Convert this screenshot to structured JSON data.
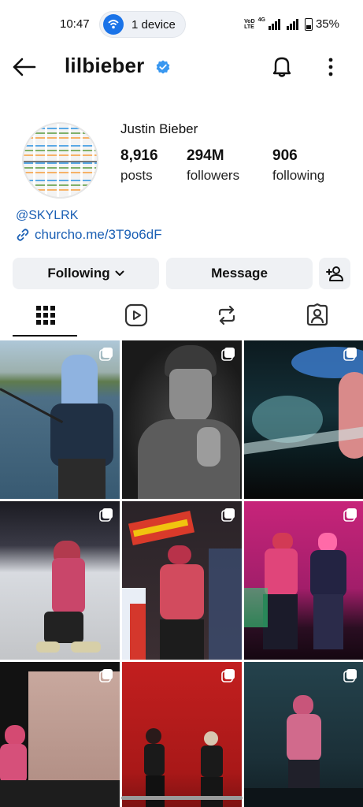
{
  "status_bar": {
    "time": "10:47",
    "device_pill": "1 device",
    "network_tiny_top": "VoD",
    "network_tiny_bottom": "LTE",
    "network_gen": "4G",
    "battery": "35%"
  },
  "header": {
    "username": "lilbieber"
  },
  "profile": {
    "full_name": "Justin Bieber",
    "posts_count": "8,916",
    "posts_label": "posts",
    "followers_count": "294M",
    "followers_label": "followers",
    "following_count": "906",
    "following_label": "following",
    "threads_handle": "@SKYLRK",
    "link": "churcho.me/3T9o6dF"
  },
  "actions": {
    "following_label": "Following",
    "message_label": "Message"
  },
  "tabs": [
    "grid-icon",
    "reels-icon",
    "reposts-icon",
    "tagged-icon"
  ],
  "grid_posts": [
    {
      "id": "post-1",
      "bg": "#6f8fa6"
    },
    {
      "id": "post-2",
      "bg": "#2a2a2a"
    },
    {
      "id": "post-3",
      "bg": "#0e2227"
    },
    {
      "id": "post-4",
      "bg": "#c9cdd4"
    },
    {
      "id": "post-5",
      "bg": "#2b2226"
    },
    {
      "id": "post-6",
      "bg": "#b0236f"
    },
    {
      "id": "post-7",
      "bg": "#1a1a1a"
    },
    {
      "id": "post-8",
      "bg": "#b31b1b"
    },
    {
      "id": "post-9",
      "bg": "#1f3a44"
    }
  ],
  "colors": {
    "link_blue": "#1a5fb4",
    "verified_blue": "#3897f0",
    "button_bg": "#eff1f4"
  }
}
